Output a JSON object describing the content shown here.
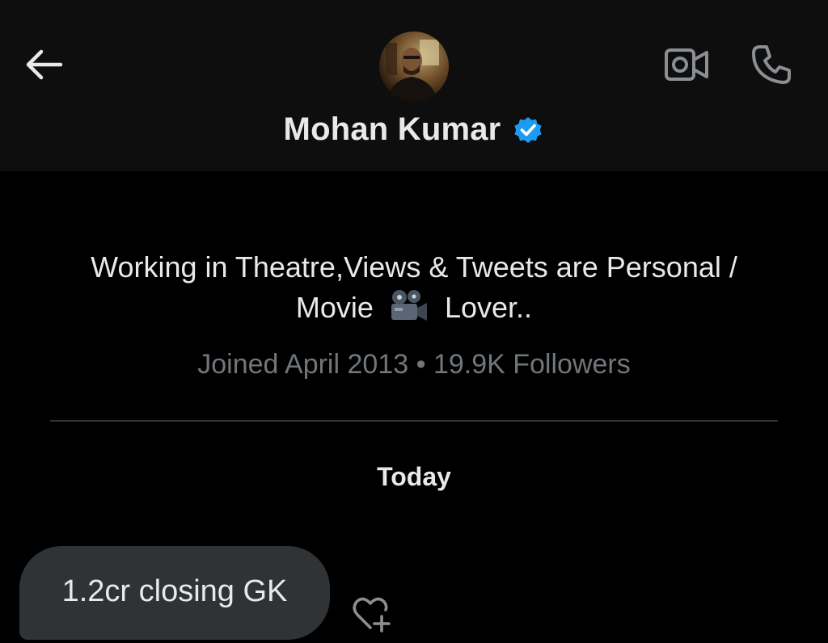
{
  "header": {
    "contact_name": "Mohan Kumar",
    "verified": true,
    "back_icon": "arrow-left-icon",
    "actions": [
      {
        "name": "video-call-button",
        "icon": "video-camera-icon"
      },
      {
        "name": "voice-call-button",
        "icon": "phone-icon"
      }
    ]
  },
  "profile": {
    "bio_line1": "Working in Theatre,Views & Tweets are Personal /",
    "bio_line2_before": "Movie",
    "bio_emoji": "movie-camera-emoji",
    "bio_line2_after": "Lover..",
    "joined": "Joined April 2013",
    "separator": "•",
    "followers": "19.9K Followers"
  },
  "conversation": {
    "day_label": "Today",
    "messages": [
      {
        "text": "1.2cr closing GK",
        "direction": "incoming",
        "reaction_icon": "heart-plus-icon"
      }
    ]
  },
  "colors": {
    "background": "#000000",
    "header_background": "#0e0e0e",
    "bubble": "#2f3336",
    "muted_text": "#71767b",
    "verified_blue": "#1d9bf0",
    "icon_gray": "#8b8f94"
  }
}
